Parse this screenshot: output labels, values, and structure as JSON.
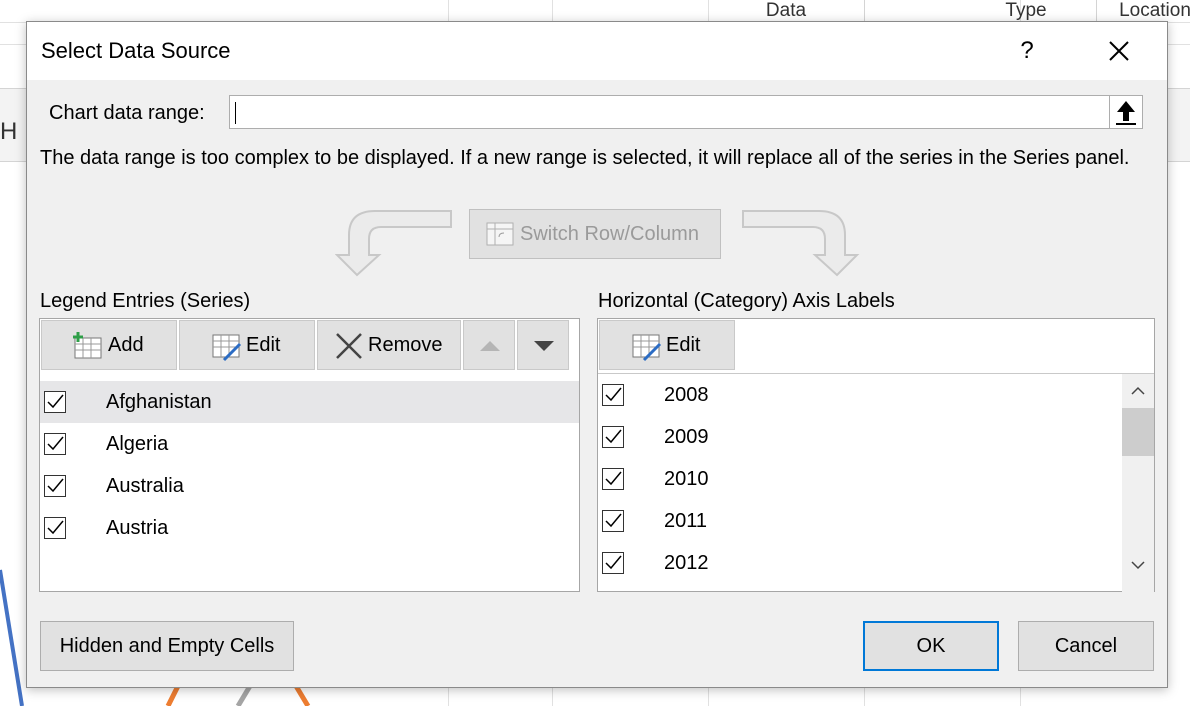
{
  "sheet": {
    "columns": [
      "Data",
      "Type",
      "Location"
    ],
    "row_header_letter": "H"
  },
  "dialog": {
    "title": "Select Data Source",
    "help_glyph": "?",
    "chart_range_label": "Chart data range:",
    "chart_range_value": "",
    "note": "The data range is too complex to be displayed. If a new range is selected, it will replace all of the series in the Series panel.",
    "switch_label": "Switch Row/Column",
    "legend": {
      "title": "Legend Entries (Series)",
      "buttons": {
        "add": "Add",
        "edit": "Edit",
        "remove": "Remove"
      },
      "items": [
        {
          "label": "Afghanistan",
          "checked": true,
          "selected": true
        },
        {
          "label": "Algeria",
          "checked": true,
          "selected": false
        },
        {
          "label": "Australia",
          "checked": true,
          "selected": false
        },
        {
          "label": "Austria",
          "checked": true,
          "selected": false
        }
      ]
    },
    "axis": {
      "title": "Horizontal (Category) Axis Labels",
      "buttons": {
        "edit": "Edit"
      },
      "items": [
        {
          "label": "2008",
          "checked": true
        },
        {
          "label": "2009",
          "checked": true
        },
        {
          "label": "2010",
          "checked": true
        },
        {
          "label": "2011",
          "checked": true
        },
        {
          "label": "2012",
          "checked": true
        }
      ]
    },
    "hidden_cells_label": "Hidden and Empty Cells",
    "ok_label": "OK",
    "cancel_label": "Cancel"
  },
  "colors": {
    "dialog_bg": "#f0f0f0",
    "button_bg": "#e1e1e1",
    "default_border": "#0078d7",
    "selected_row": "#e6e6e8",
    "arrow_gray": "#c8c8c8"
  }
}
